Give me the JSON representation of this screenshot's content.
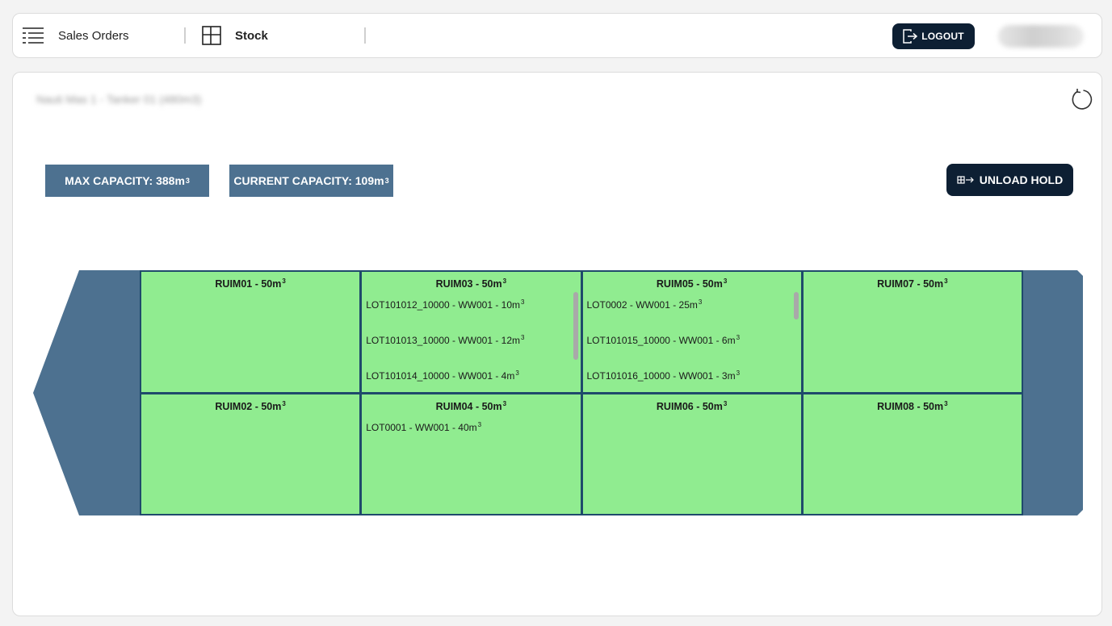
{
  "header": {
    "nav": [
      {
        "label": "Sales Orders",
        "icon": "list-menu-icon"
      },
      {
        "label": "Stock",
        "icon": "layout-grid-icon"
      }
    ],
    "logout_label": "LOGOUT",
    "logout_icon": "logout-icon"
  },
  "main": {
    "vessel_title": "Nauti Mas 1 - Tanker 01 (480m3)",
    "refresh_icon": "refresh-icon",
    "max_capacity": {
      "label": "MAX CAPACITY: 388m",
      "sup": "3"
    },
    "current_capacity": {
      "label": "CURRENT CAPACITY: 109m",
      "sup": "3"
    },
    "unload_label": "UNLOAD HOLD",
    "unload_icon": "unload-hold-icon"
  },
  "colors": {
    "hull": "#4d7190",
    "hold_fill": "#90ec90",
    "hold_border": "#1f4a6b",
    "button_dark": "#0d1f33"
  },
  "holds": [
    {
      "name": "RUIM01 - 50m",
      "sup": "3",
      "lots": [],
      "scrollbar": false
    },
    {
      "name": "RUIM03 - 50m",
      "sup": "3",
      "lots": [
        {
          "label": "LOT101012_10000 - WW001 - 10m",
          "sup": "3"
        },
        {
          "label": "LOT101013_10000 - WW001 - 12m",
          "sup": "3"
        },
        {
          "label": "LOT101014_10000 - WW001 - 4m",
          "sup": "3"
        }
      ],
      "scrollbar": true
    },
    {
      "name": "RUIM05 - 50m",
      "sup": "3",
      "lots": [
        {
          "label": "LOT0002 - WW001 - 25m",
          "sup": "3"
        },
        {
          "label": "LOT101015_10000 - WW001 - 6m",
          "sup": "3"
        },
        {
          "label": "LOT101016_10000 - WW001 - 3m",
          "sup": "3"
        }
      ],
      "scrollbar": true
    },
    {
      "name": "RUIM07 - 50m",
      "sup": "3",
      "lots": [],
      "scrollbar": false
    },
    {
      "name": "RUIM02 - 50m",
      "sup": "3",
      "lots": [],
      "scrollbar": false
    },
    {
      "name": "RUIM04 - 50m",
      "sup": "3",
      "lots": [
        {
          "label": "LOT0001 - WW001 - 40m",
          "sup": "3"
        }
      ],
      "scrollbar": false
    },
    {
      "name": "RUIM06 - 50m",
      "sup": "3",
      "lots": [],
      "scrollbar": false
    },
    {
      "name": "RUIM08 - 50m",
      "sup": "3",
      "lots": [],
      "scrollbar": false
    }
  ]
}
